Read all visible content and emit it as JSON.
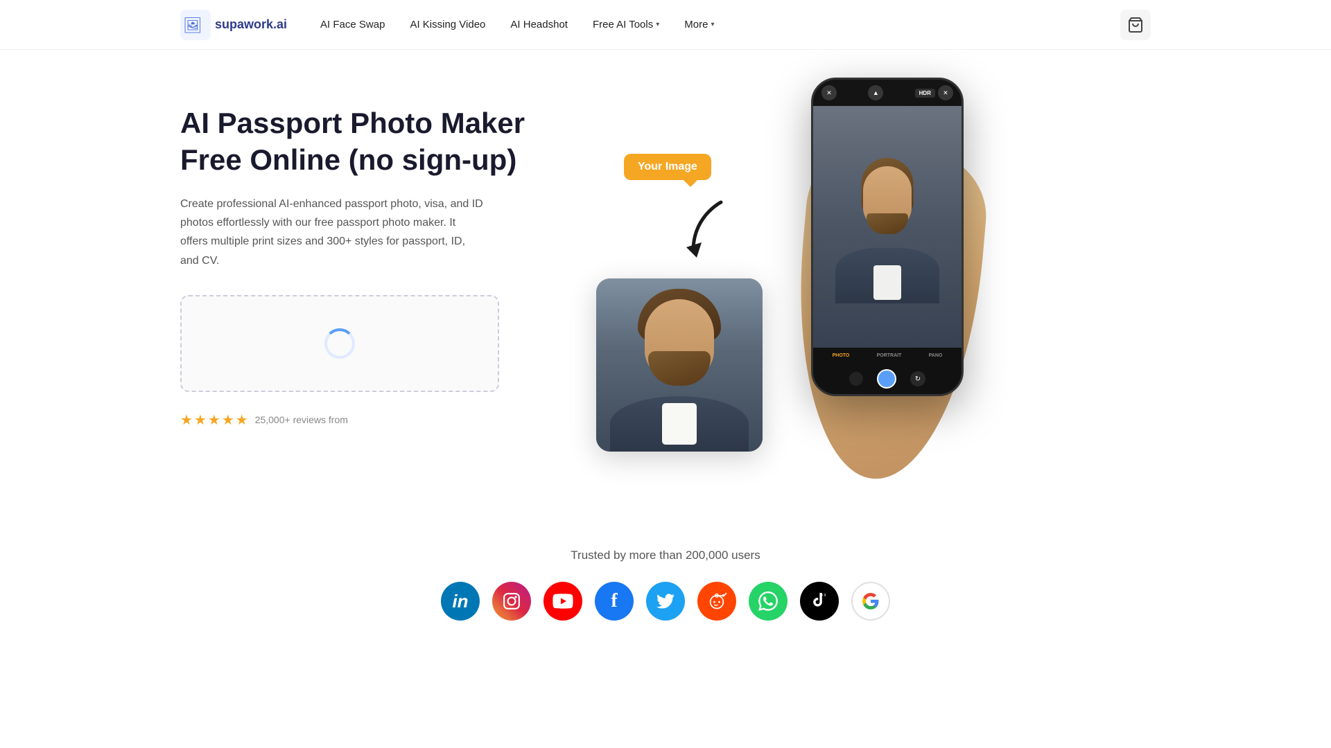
{
  "brand": {
    "name": "supawork.ai",
    "logo_text": "supawork.ai"
  },
  "navbar": {
    "links": [
      {
        "id": "ai-face-swap",
        "label": "AI Face Swap",
        "has_dropdown": false
      },
      {
        "id": "ai-kissing-video",
        "label": "AI Kissing Video",
        "has_dropdown": false
      },
      {
        "id": "ai-headshot",
        "label": "AI Headshot",
        "has_dropdown": false
      },
      {
        "id": "free-ai-tools",
        "label": "Free AI Tools",
        "has_dropdown": true
      },
      {
        "id": "more",
        "label": "More",
        "has_dropdown": true
      }
    ],
    "cart_label": "Cart"
  },
  "hero": {
    "title": "AI Passport Photo Maker Free Online (no sign-up)",
    "description": "Create professional AI-enhanced passport photo, visa, and ID photos effortlessly with our free passport photo maker. It offers multiple print sizes and 300+ styles for passport, ID, and CV.",
    "upload_hint": "Loading...",
    "reviews_count": "25,000+ reviews from",
    "stars": 4.5
  },
  "image_section": {
    "your_image_label": "Your Image",
    "phone_modes": [
      "PHOTO",
      "PORTRAIT",
      "PANO"
    ],
    "active_mode": "PHOTO"
  },
  "trusted": {
    "title": "Trusted by more than 200,000 users",
    "social_platforms": [
      {
        "id": "linkedin",
        "label": "in",
        "style": "linkedin"
      },
      {
        "id": "instagram",
        "label": "📷",
        "style": "instagram"
      },
      {
        "id": "youtube",
        "label": "▶",
        "style": "youtube"
      },
      {
        "id": "facebook",
        "label": "f",
        "style": "facebook"
      },
      {
        "id": "twitter",
        "label": "🐦",
        "style": "twitter"
      },
      {
        "id": "reddit",
        "label": "👾",
        "style": "reddit"
      },
      {
        "id": "whatsapp",
        "label": "📞",
        "style": "whatsapp"
      },
      {
        "id": "tiktok",
        "label": "♪",
        "style": "tiktok"
      },
      {
        "id": "google",
        "label": "G",
        "style": "google"
      }
    ]
  }
}
